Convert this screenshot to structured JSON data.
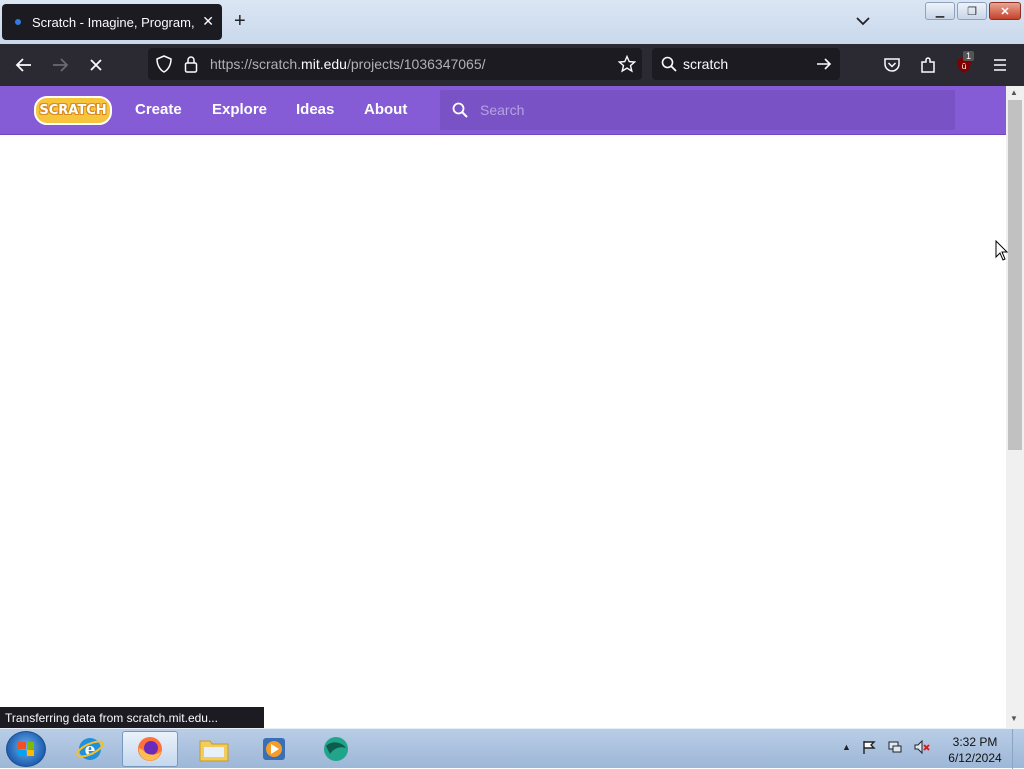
{
  "browser": {
    "tab": {
      "title": "Scratch - Imagine, Program, Share",
      "close_icon": "close-icon"
    },
    "url": {
      "prefix": "https://scratch.",
      "host": "mit.edu",
      "path": "/projects/1036347065/"
    },
    "search": {
      "value": "scratch"
    },
    "status": "Transferring data from scratch.mit.edu...",
    "extension_badge": "1"
  },
  "scratch": {
    "logo": "SCRATCH",
    "menu": [
      "Create",
      "Explore",
      "Ideas",
      "About"
    ],
    "search_placeholder": "Search",
    "accent": "#855cd6"
  },
  "taskbar": {
    "time": "3:32 PM",
    "date": "6/12/2024"
  }
}
